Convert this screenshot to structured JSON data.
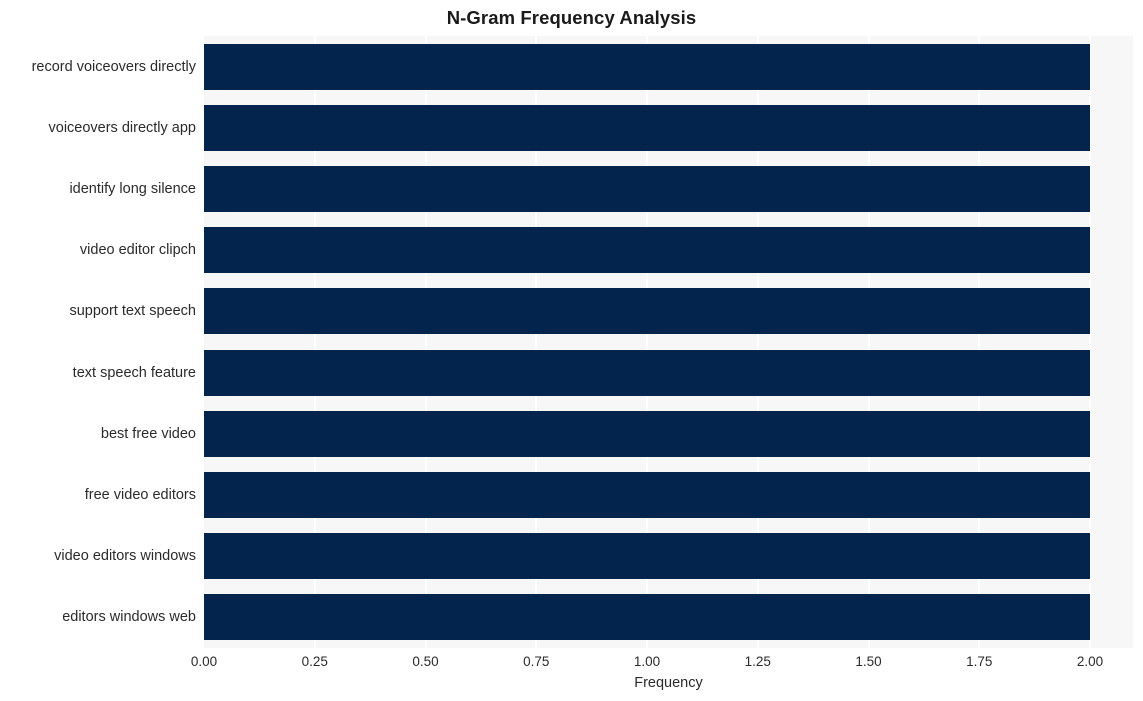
{
  "chart_data": {
    "type": "bar",
    "orientation": "horizontal",
    "title": "N-Gram Frequency Analysis",
    "xlabel": "Frequency",
    "ylabel": "",
    "xlim": [
      0,
      2
    ],
    "ylim": null,
    "grid": true,
    "legend": null,
    "bar_color": "#03244d",
    "plot_background": "#f7f7f7",
    "gridline_color": "#ffffff",
    "xticks": [
      "0.00",
      "0.25",
      "0.50",
      "0.75",
      "1.00",
      "1.25",
      "1.50",
      "1.75",
      "2.00"
    ],
    "xtick_values": [
      0,
      0.25,
      0.5,
      0.75,
      1,
      1.25,
      1.5,
      1.75,
      2
    ],
    "categories": [
      "record voiceovers directly",
      "voiceovers directly app",
      "identify long silence",
      "video editor clipch",
      "support text speech",
      "text speech feature",
      "best free video",
      "free video editors",
      "video editors windows",
      "editors windows web"
    ],
    "values": [
      2,
      2,
      2,
      2,
      2,
      2,
      2,
      2,
      2,
      2
    ]
  }
}
